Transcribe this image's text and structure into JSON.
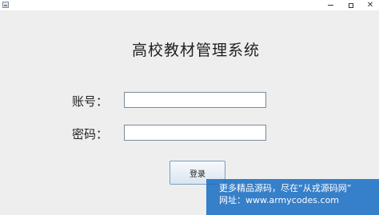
{
  "window": {
    "icon": "java-app-icon",
    "minimize_glyph": "minimize-icon",
    "maximize_glyph": "maximize-icon",
    "close_label": "✕"
  },
  "form": {
    "title": "高校教材管理系统",
    "account_label": "账号：",
    "account_value": "",
    "password_label": "密码：",
    "password_value": "",
    "login_label": "登录"
  },
  "watermark": {
    "line1": "更多精品源码，尽在“从戎源码网”",
    "line2": "网址：www.armycodes.com",
    "background": "#1c70c4"
  }
}
